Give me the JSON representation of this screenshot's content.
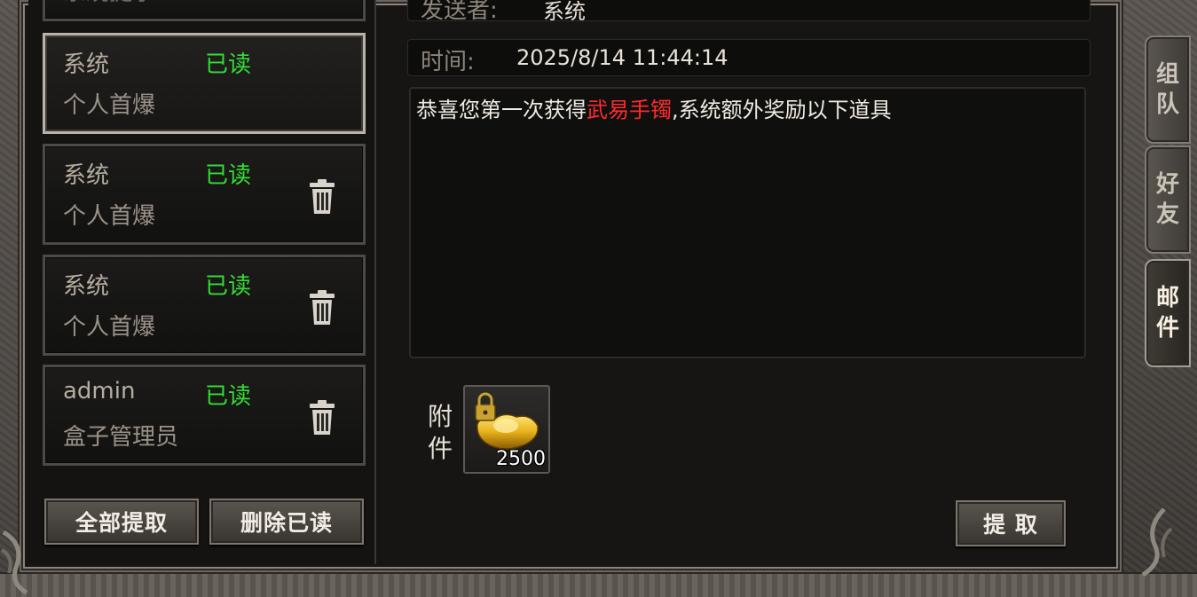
{
  "mail_list": {
    "top_partial_subject": "系统提示",
    "items": [
      {
        "sender": "系统",
        "status": "已读",
        "subject": "个人首爆",
        "selected": true
      },
      {
        "sender": "系统",
        "status": "已读",
        "subject": "个人首爆",
        "selected": false
      },
      {
        "sender": "系统",
        "status": "已读",
        "subject": "个人首爆",
        "selected": false
      },
      {
        "sender": "admin",
        "status": "已读",
        "subject": "盒子管理员",
        "selected": false
      }
    ],
    "claim_all_label": "全部提取",
    "delete_read_label": "删除已读"
  },
  "detail": {
    "sender_label": "发送者:",
    "sender_value": "系统",
    "time_label": "时间:",
    "time_value": "2025/8/14 11:44:14",
    "body_prefix": "恭喜您第一次获得",
    "body_highlight": "武易手镯",
    "body_suffix": ",系统额外奖励以下道具",
    "attach_label_1": "附",
    "attach_label_2": "件",
    "attachment": {
      "icon": "gold-ingot-icon",
      "count": "2500",
      "locked": true
    },
    "claim_label": "提 取"
  },
  "side_tabs": [
    {
      "line1": "组",
      "line2": "队"
    },
    {
      "line1": "好",
      "line2": "友"
    },
    {
      "line1": "邮",
      "line2": "件"
    }
  ],
  "colors": {
    "read_status": "#33dd33",
    "highlight": "#ff2a2a"
  }
}
